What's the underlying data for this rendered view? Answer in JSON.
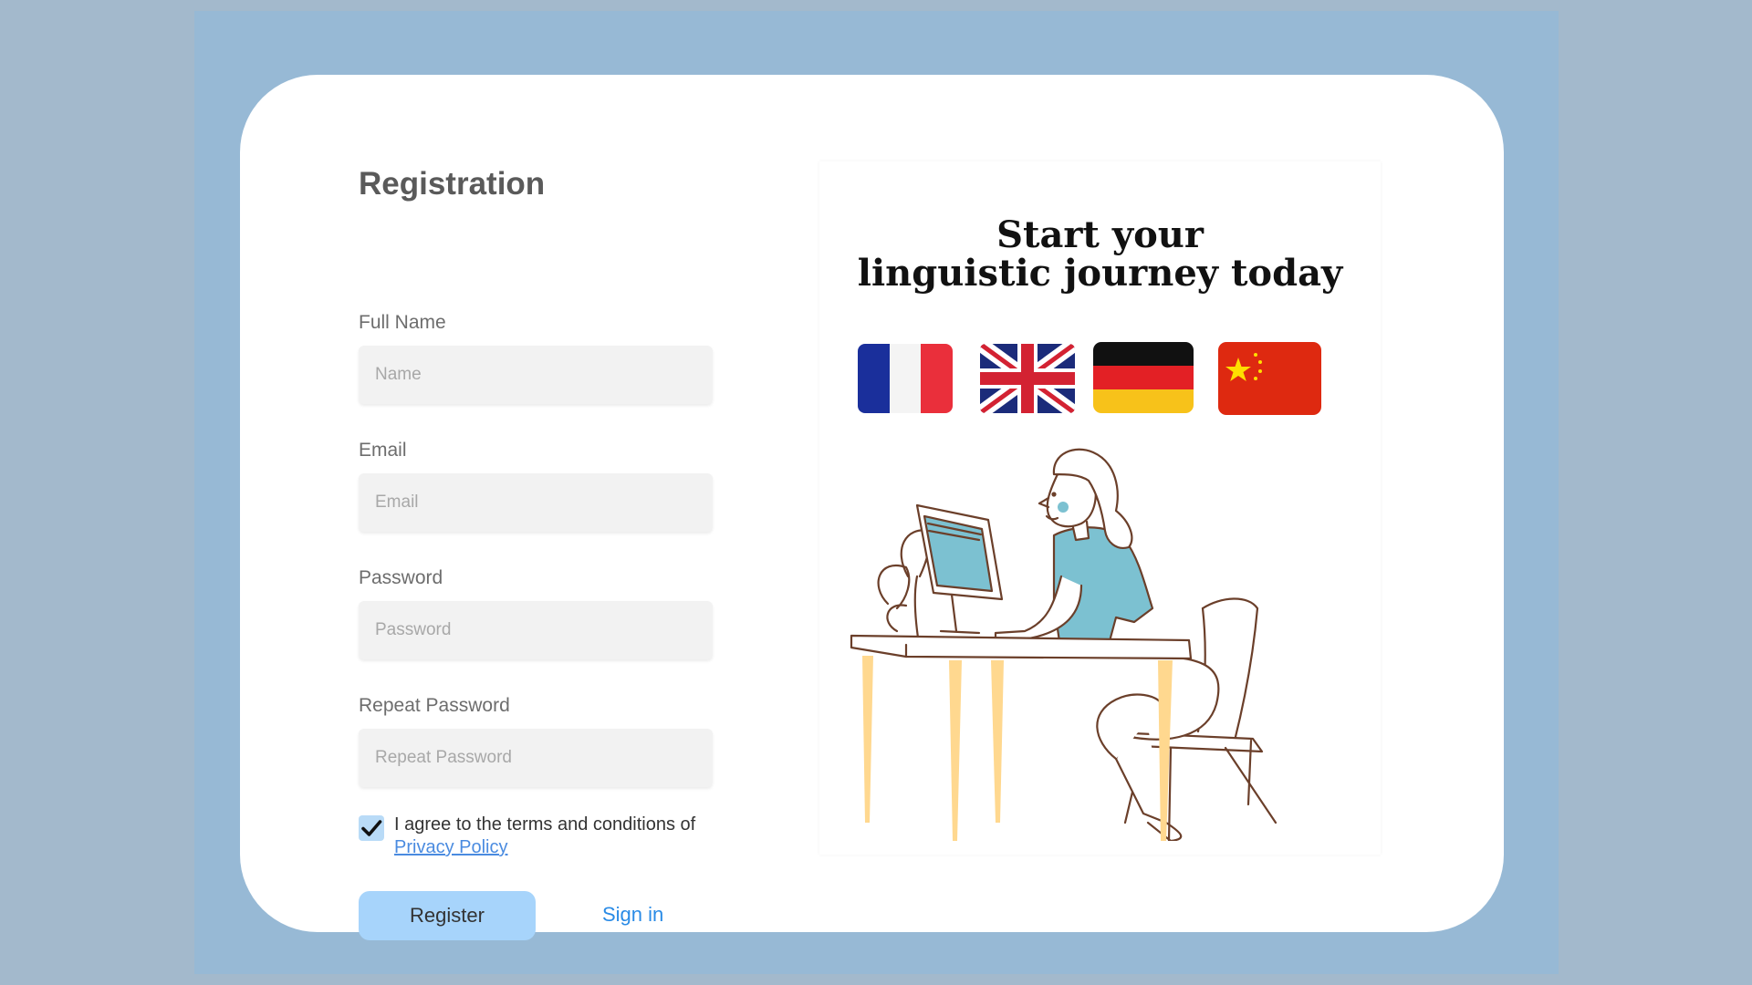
{
  "form": {
    "title": "Registration",
    "fields": [
      {
        "label": "Full Name",
        "placeholder": "Name",
        "value": ""
      },
      {
        "label": "Email",
        "placeholder": "Email",
        "value": ""
      },
      {
        "label": "Password",
        "placeholder": "Password",
        "value": ""
      },
      {
        "label": "Repeat Password",
        "placeholder": "Repeat Password",
        "value": ""
      }
    ],
    "agree_text": "I agree to the terms and conditions of",
    "agree_checked": true,
    "privacy_link": "Privacy Policy",
    "register_label": "Register",
    "signin_label": "Sign in"
  },
  "promo": {
    "title_line1": "Start your",
    "title_line2": "linguistic journey today",
    "flags": [
      "france-flag",
      "uk-flag",
      "germany-flag",
      "china-flag"
    ]
  },
  "colors": {
    "background": "#a3b9cc",
    "stage": "#97b9d5",
    "register_button": "#a7d4fb",
    "link": "#2a8be6",
    "privacy_link": "#4a8be0",
    "input_bg": "#f2f2f2"
  }
}
